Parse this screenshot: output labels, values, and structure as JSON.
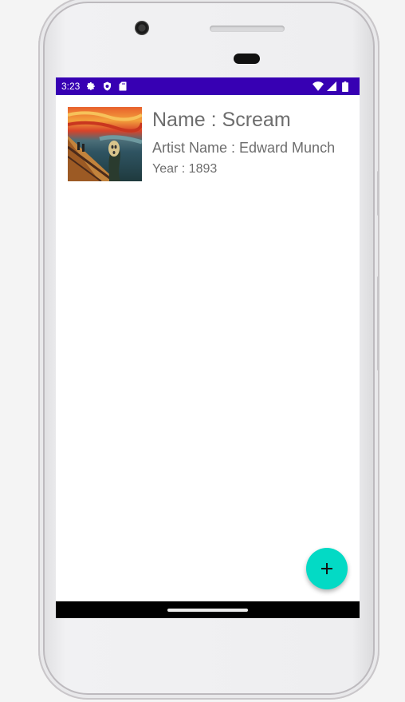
{
  "status_bar": {
    "time": "3:23",
    "left_icons": [
      "settings-icon",
      "shield-icon",
      "sd-card-icon"
    ],
    "right_icons": [
      "wifi-icon",
      "signal-icon",
      "battery-icon"
    ],
    "background_color": "#3700b3"
  },
  "art_list": {
    "items": [
      {
        "name": "Name : Scream",
        "artist": "Artist Name : Edward Munch",
        "year": "Year : 1893"
      }
    ]
  },
  "fab": {
    "label": "+",
    "icon": "add-icon",
    "color": "#03dac5"
  }
}
